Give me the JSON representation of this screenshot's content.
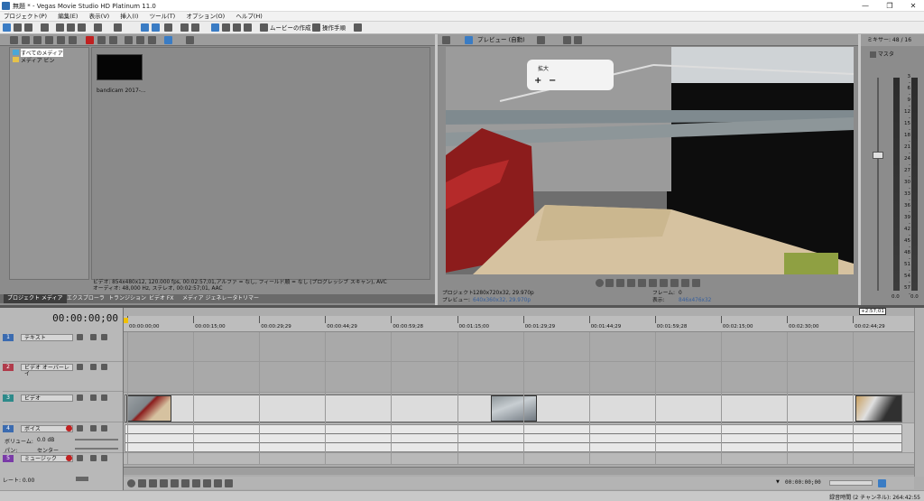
{
  "app": {
    "title": "無題 * - Vegas Movie Studio HD Platinum 11.0",
    "window_buttons": [
      "—",
      "❐",
      "✕"
    ]
  },
  "menu": [
    "プロジェクト(P)",
    "編集(E)",
    "表示(V)",
    "挿入(I)",
    "ツール(T)",
    "オプション(O)",
    "ヘルプ(H)"
  ],
  "toolbar": {
    "make_movie_label": "ムービーの作成",
    "tutorial_label": "操作手順"
  },
  "explorer": {
    "tree_items": [
      "すべてのメディア",
      "メディア ビン"
    ],
    "media_thumb_label": "bandicam 2017-...",
    "info_line1": "ビデオ: 854x480x12, 120.000 fps, 00:02:57;01,アルファ = なし, フィールド順 = なし (プログレッシブ スキャン), AVC",
    "info_line2": "オーディオ: 48,000 Hz, ステレオ, 00:02:57;01, AAC",
    "tabs": [
      "プロジェクト メディア",
      "エクスプローラ",
      "トランジション",
      "ビデオ FX",
      "メディア ジェネレータ",
      "トリマー"
    ]
  },
  "preview": {
    "mode_label": "プレビュー (自動)",
    "overlay_title": "拡大",
    "project_label": "プロジェクト:",
    "project_value": "1280x720x32, 29.970p",
    "preview_label": "プレビュー:",
    "preview_value": "640x360x32, 29.970p",
    "frame_label": "フレーム:",
    "frame_value": "0",
    "display_label": "表示:",
    "display_value": "846x476x32"
  },
  "mixer": {
    "title": "ミキサー: 48 / 16",
    "master_label": "マスタ",
    "scale": [
      "3",
      "-",
      "6",
      "-",
      "9",
      "-",
      "12",
      "-",
      "15",
      "-",
      "18",
      "-",
      "21",
      "-",
      "24",
      "-",
      "27",
      "-",
      "30",
      "-",
      "33",
      "-",
      "36",
      "-",
      "39",
      "-",
      "42",
      "-",
      "45",
      "-",
      "48",
      "-",
      "51",
      "-",
      "54",
      "-",
      "57",
      "-"
    ],
    "left_value": "0.0",
    "right_value": "0.0"
  },
  "timeline": {
    "current_time": "00:00:00;00",
    "end_marker": "+2:57;01",
    "ruler_labels": [
      "00:00:00;00",
      "00:00:15;00",
      "00:00:29;29",
      "00:00:44;29",
      "00:00:59;28",
      "00:01:15;00",
      "00:01:29;29",
      "00:01:44;29",
      "00:01:59;28",
      "00:02:15;00",
      "00:02:30;00",
      "00:02:44;29"
    ],
    "tracks": [
      {
        "num": "1",
        "name": "テキスト",
        "color": "#3b6bb0"
      },
      {
        "num": "2",
        "name": "ビデオ オーバーレイ",
        "color": "#b03b4b"
      },
      {
        "num": "3",
        "name": "ビデオ",
        "color": "#2d8a8a"
      },
      {
        "num": "4",
        "name": "ボイス",
        "color": "#3b6bb0"
      },
      {
        "num": "5",
        "name": "ミュージック",
        "color": "#7a3ba8"
      }
    ],
    "volume_label": "ボリューム:",
    "volume_value": "0.0 dB",
    "pan_label": "パン:",
    "pan_value": "センター",
    "rate_label": "レート: 0.00",
    "playbar_time": "00:00:00;00"
  },
  "status": {
    "record_time": "録音時間 (2 チャンネル): 264:42:55"
  },
  "colors": {
    "panel_bg": "#8c8c8c",
    "timeline_bg": "#adadad",
    "accent": "#3a7cc4"
  }
}
